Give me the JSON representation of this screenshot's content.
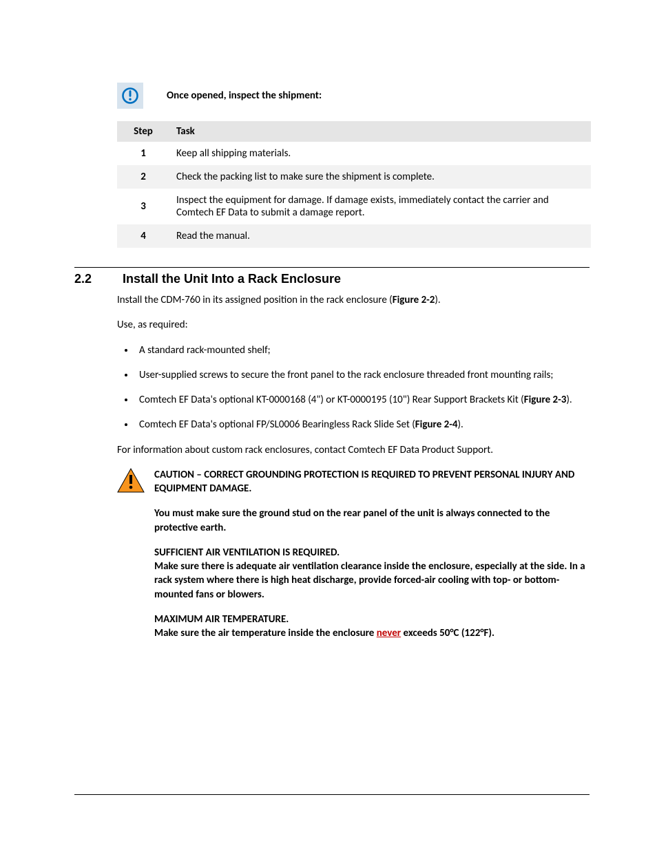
{
  "note": {
    "text": "Once opened, inspect the shipment:"
  },
  "table": {
    "head_step": "Step",
    "head_task": "Task",
    "rows": [
      {
        "n": "1",
        "task": "Keep all shipping materials."
      },
      {
        "n": "2",
        "task": "Check the packing list to make sure the shipment is complete."
      },
      {
        "n": "3",
        "task": "Inspect the equipment for damage. If damage exists, immediately contact the carrier and Comtech EF Data to submit a damage report."
      },
      {
        "n": "4",
        "task": "Read the manual."
      }
    ]
  },
  "section": {
    "num": "2.2",
    "title": "Install the Unit Into a Rack Enclosure",
    "intro_a": "Install the CDM-760 in its assigned position in the rack enclosure (",
    "intro_fig": "Figure 2-2",
    "intro_b": ").",
    "use": "Use, as required:",
    "bullets": {
      "b1": "A standard rack-mounted shelf;",
      "b2": "User-supplied screws to secure the front panel to the rack enclosure threaded front mounting rails;",
      "b3_a": "Comtech EF Data's optional KT-0000168 (4\") or KT-0000195 (10\") Rear Support Brackets Kit (",
      "b3_fig": "Figure 2-3",
      "b3_b": ").",
      "b4_a": "Comtech EF Data's optional FP/SL0006 Bearingless Rack Slide Set (",
      "b4_fig": "Figure 2-4",
      "b4_b": ")."
    },
    "after": "For information about custom rack enclosures, contact Comtech EF Data Product Support."
  },
  "caution": {
    "p1": "CAUTION – CORRECT GROUNDING PROTECTION IS REQUIRED TO PREVENT PERSONAL INJURY AND EQUIPMENT DAMAGE.",
    "p2": "You must make sure the ground stud on the rear panel of the unit is always connected to the protective earth.",
    "p3_title": "SUFFICIENT AIR VENTILATION IS REQUIRED.",
    "p3_body": " Make sure there is adequate air ventilation clearance inside the enclosure, especially at the side. In a rack system where there is high heat discharge, provide forced-air cooling with top- or bottom-mounted fans or blowers.",
    "p4_title": "MAXIMUM AIR TEMPERATURE.",
    "p4_a": "Make sure the air temperature inside the enclosure ",
    "p4_never": "never",
    "p4_b": " exceeds 50°C (122°F)."
  }
}
